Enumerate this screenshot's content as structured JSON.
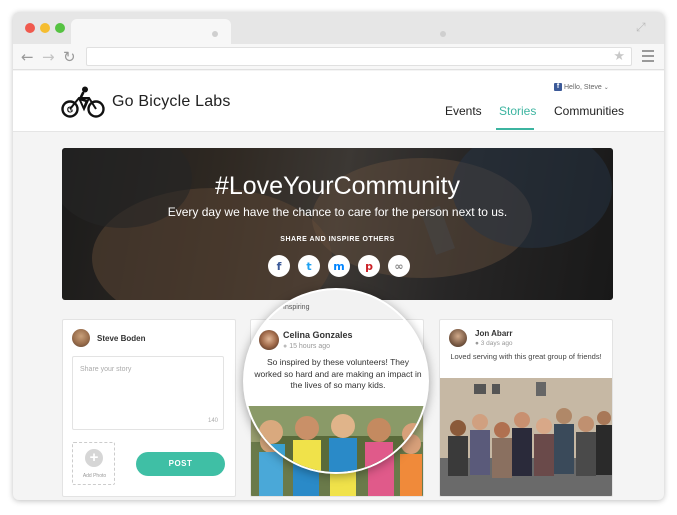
{
  "browser": {
    "back_icon": "arrow-left-icon",
    "forward_icon": "arrow-right-icon",
    "reload_icon": "reload-icon",
    "bookmark_icon": "star-icon",
    "menu_icon": "hamburger-menu-icon"
  },
  "site": {
    "brand": "Go Bicycle Labs",
    "account": "Hello, Steve",
    "nav": [
      {
        "label": "Events"
      },
      {
        "label": "Stories"
      },
      {
        "label": "Communities"
      }
    ],
    "accent": "#3cb4a0"
  },
  "hero": {
    "title": "#LoveYourCommunity",
    "subtitle": "Every day we have the chance to care for the person next to us.",
    "share_label": "SHARE AND INSPIRE OTHERS",
    "share_buttons": [
      "f",
      "t",
      "m",
      "p",
      "∞"
    ]
  },
  "compose": {
    "name": "Steve Boden",
    "placeholder": "Share your story",
    "char_count": "140",
    "add_photo": "Add Photo",
    "post": "POST"
  },
  "story_middle": {
    "header": "Inspiring",
    "name": "Celina Gonzales",
    "time": "15 hours ago",
    "text": "So inspired by these volunteers! They worked so hard and are making an impact in the lives of so many kids."
  },
  "story_right": {
    "name": "Jon Abarr",
    "time": "3 days ago",
    "text": "Loved serving with this great group of friends!"
  }
}
